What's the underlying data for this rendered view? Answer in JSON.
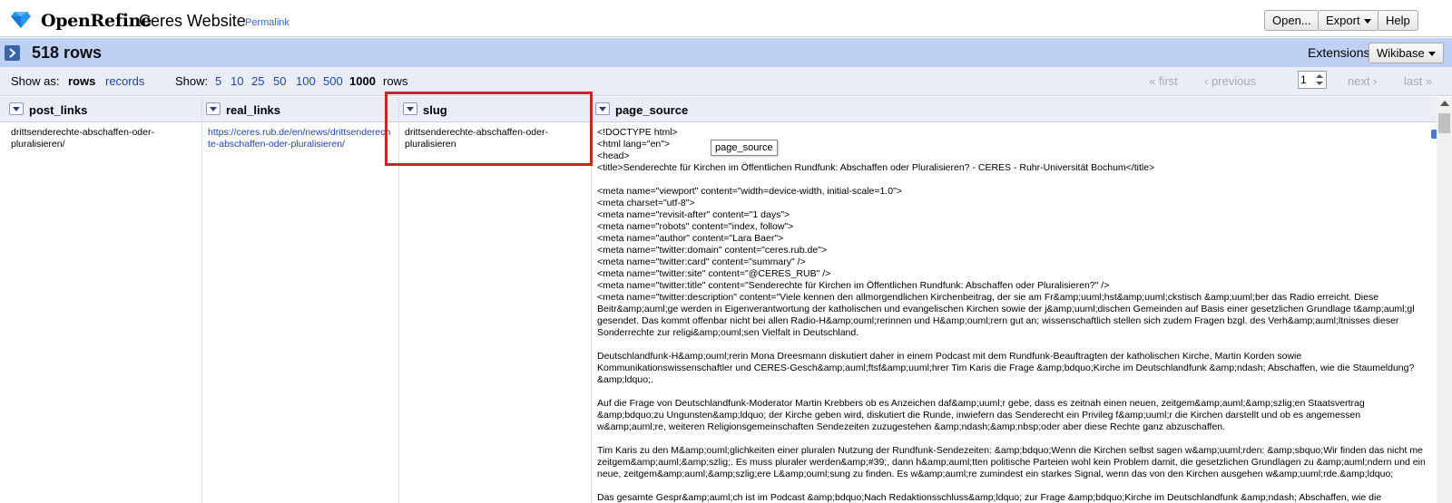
{
  "app": {
    "logo_text": "OpenRefine",
    "project_name": "Ceres Website",
    "permalink": "Permalink",
    "open_btn": "Open...",
    "export_btn": "Export",
    "help_btn": "Help",
    "brand_color": "#3a63a8"
  },
  "summary": {
    "rows_count": "518 rows",
    "extensions_label": "Extensions",
    "wikibase_btn": "Wikibase"
  },
  "controls": {
    "show_as": "Show as:",
    "rows": "rows",
    "records": "records",
    "show": "Show:",
    "page_sizes": [
      "5",
      "10",
      "25",
      "50",
      "100",
      "500",
      "1000"
    ],
    "selected_size": "1000",
    "rows_suffix": "rows",
    "first": "« first",
    "previous": "‹ previous",
    "page": "1",
    "next": "next ›",
    "last": "last »"
  },
  "columns": [
    "post_links",
    "real_links",
    "slug",
    "page_source"
  ],
  "row": {
    "post_links": "drittsenderechte-abschaffen-oder-pluralisieren/",
    "real_links": "https://ceres.rub.de/en/news/drittsenderechte-abschaffen-oder-pluralisieren/",
    "slug": "drittsenderechte-abschaffen-oder-pluralisieren",
    "page_source": "<!DOCTYPE html>\n<html lang=\"en\">\n<head>\n<title>Senderechte für Kirchen im Öffentlichen Rundfunk: Abschaffen oder Pluralisieren? - CERES - Ruhr-Universität Bochum</title>\n\n<meta name=\"viewport\" content=\"width=device-width, initial-scale=1.0\">\n<meta charset=\"utf-8\">\n<meta name=\"revisit-after\" content=\"1 days\">\n<meta name=\"robots\" content=\"index, follow\">\n<meta name=\"author\" content=\"Lara Baer\">\n<meta name=\"twitter:domain\" content=\"ceres.rub.de\">\n<meta name=\"twitter:card\" content=\"summary\" />\n<meta name=\"twitter:site\" content=\"@CERES_RUB\" />\n<meta name=\"twitter:title\" content=\"Senderechte für Kirchen im Öffentlichen Rundfunk: Abschaffen oder Pluralisieren?\" />\n<meta name=\"twitter:description\" content=\"Viele kennen den allmorgendlichen Kirchenbeitrag, der sie am Fr&amp;uuml;hst&amp;uuml;ckstisch &amp;uuml;ber das Radio erreicht. Diese Beitr&amp;auml;ge werden in Eigenverantwortung der katholischen und evangelischen Kirchen sowie der j&amp;uuml;dischen Gemeinden auf Basis einer gesetzlichen Grundlage t&amp;auml;gl gesendet. Das kommt offenbar nicht bei allen Radio-H&amp;ouml;rerinnen und H&amp;ouml;rern gut an; wissenschaftlich stellen sich zudem Fragen bzgl. des Verh&amp;auml;ltnisses dieser Sonderrechte zur religi&amp;ouml;sen Vielfalt in Deutschland.\n\nDeutschlandfunk-H&amp;ouml;rerin Mona Dreesmann diskutiert daher in einem Podcast mit dem Rundfunk-Beauftragten der katholischen Kirche, Martin Korden sowie Kommunikationswissenschaftler und CERES-Gesch&amp;auml;ftsf&amp;uuml;hrer Tim Karis die Frage &amp;bdquo;Kirche im Deutschlandfunk &amp;ndash; Abschaffen, wie die Staumeldung?&amp;ldquo;.\n\nAuf die Frage von Deutschlandfunk-Moderator Martin Krebbers ob es Anzeichen daf&amp;uuml;r gebe, dass es zeitnah einen neuen, zeitgem&amp;auml;&amp;szlig;en Staatsvertrag &amp;bdquo;zu Ungunsten&amp;ldquo; der Kirche geben wird, diskutiert die Runde, inwiefern das Senderecht ein Privileg f&amp;uuml;r die Kirchen darstellt und ob es angemessen w&amp;auml;re, weiteren Religionsgemeinschaften Sendezeiten zuzugestehen &amp;ndash;&amp;nbsp;oder aber diese Rechte ganz abzuschaffen.\n\nTim Karis zu den M&amp;ouml;glichkeiten einer pluralen Nutzung der Rundfunk-Sendezeiten: &amp;bdquo;Wenn die Kirchen selbst sagen w&amp;uuml;rden: &amp;sbquo;Wir finden das nicht me zeitgem&amp;auml;&amp;szlig;. Es muss pluraler werden&amp;#39;, dann h&amp;auml;tten politische Parteien wohl kein Problem damit, die gesetzlichen Grundlagen zu &amp;auml;ndern und ein neue, zeitgem&amp;auml;&amp;szlig;ere L&amp;ouml;sung zu finden. Es w&amp;auml;re zumindest ein starkes Signal, wenn das von den Kirchen ausgehen w&amp;uuml;rde.&amp;ldquo;\n\nDas gesamte Gespr&amp;auml;ch ist im Podcast &amp;bdquo;Nach Redaktionsschluss&amp;ldquo; zur Frage &amp;bdquo;Kirche im Deutschlandfunk &amp;ndash; Abschaffen, wie die"
  },
  "tooltip": "page_source"
}
